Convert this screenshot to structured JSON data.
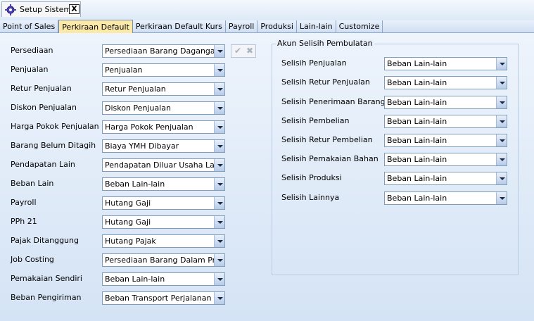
{
  "window": {
    "tab_title": "Setup Sistem",
    "close_glyph": "X"
  },
  "tabs": [
    {
      "label": "Point of Sales",
      "active": false
    },
    {
      "label": "Perkiraan Default",
      "active": true
    },
    {
      "label": "Perkiraan Default Kurs",
      "active": false
    },
    {
      "label": "Payroll",
      "active": false
    },
    {
      "label": "Produksi",
      "active": false
    },
    {
      "label": "Lain-lain",
      "active": false
    },
    {
      "label": "Customize",
      "active": false
    }
  ],
  "left_fields": [
    {
      "label": "Persediaan",
      "value": "Persediaan Barang Dagangan"
    },
    {
      "label": "Penjualan",
      "value": "Penjualan"
    },
    {
      "label": "Retur Penjualan",
      "value": "Retur Penjualan"
    },
    {
      "label": "Diskon Penjualan",
      "value": "Diskon Penjualan"
    },
    {
      "label": "Harga Pokok Penjualan",
      "value": "Harga Pokok Penjualan"
    },
    {
      "label": "Barang Belum Ditagih",
      "value": "Biaya YMH Dibayar"
    },
    {
      "label": "Pendapatan Lain",
      "value": "Pendapatan Diluar Usaha Lain - L"
    },
    {
      "label": "Beban Lain",
      "value": "Beban Lain-lain"
    },
    {
      "label": "Payroll",
      "value": "Hutang Gaji"
    },
    {
      "label": "PPh 21",
      "value": "Hutang Gaji"
    },
    {
      "label": "Pajak Ditanggung",
      "value": "Hutang Pajak"
    },
    {
      "label": "Job Costing",
      "value": "Persediaan Barang Dalam Proses"
    },
    {
      "label": "Pemakaian Sendiri",
      "value": "Beban Lain-lain"
    },
    {
      "label": "Beban Pengiriman",
      "value": "Beban Transport Perjalanan Dinas"
    }
  ],
  "actions": {
    "ok_glyph": "✔",
    "cancel_glyph": "✖"
  },
  "group": {
    "title": "Akun Selisih Pembulatan",
    "fields": [
      {
        "label": "Selisih Penjualan",
        "value": "Beban Lain-lain"
      },
      {
        "label": "Selisih Retur Penjualan",
        "value": "Beban Lain-lain"
      },
      {
        "label": "Selisih Penerimaan Barang",
        "value": "Beban Lain-lain"
      },
      {
        "label": "Selisih Pembelian",
        "value": "Beban Lain-lain"
      },
      {
        "label": "Selisih Retur Pembelian",
        "value": "Beban Lain-lain"
      },
      {
        "label": "Selisih Pemakaian Bahan",
        "value": "Beban Lain-lain"
      },
      {
        "label": "Selisih Produksi",
        "value": "Beban Lain-lain"
      },
      {
        "label": "Selisih Lainnya",
        "value": "Beban Lain-lain"
      }
    ]
  }
}
